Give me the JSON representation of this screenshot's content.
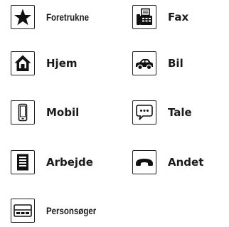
{
  "phone_types": {
    "favorites": {
      "label": "Foretrukne",
      "icon": "star-icon"
    },
    "fax": {
      "label": "Fax",
      "icon": "fax-icon"
    },
    "home": {
      "label": "Hjem",
      "icon": "home-icon"
    },
    "car": {
      "label": "Bil",
      "icon": "car-icon"
    },
    "mobile": {
      "label": "Mobil",
      "icon": "mobile-phone-icon"
    },
    "voice": {
      "label": "Tale",
      "icon": "speech-bubble-icon"
    },
    "work": {
      "label": "Arbejde",
      "icon": "office-building-icon"
    },
    "other": {
      "label": "Andet",
      "icon": "telephone-handset-icon"
    },
    "pager": {
      "label": "Personsøger",
      "icon": "pager-icon"
    }
  },
  "colors": {
    "icon": "#111111",
    "text": "#1a1a1a",
    "background": "#ffffff"
  }
}
